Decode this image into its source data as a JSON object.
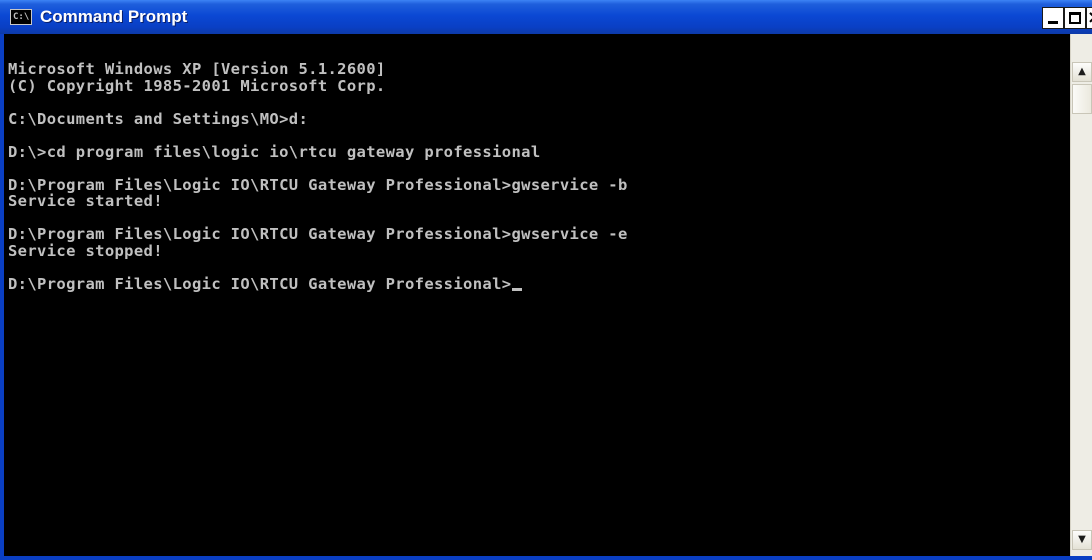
{
  "window": {
    "title": "Command Prompt",
    "icon_label": "C:\\",
    "icon": "console-icon",
    "controls": {
      "minimize_icon": "minimize-icon",
      "maximize_icon": "maximize-icon",
      "close_icon": "close-icon",
      "close_glyph": "×"
    }
  },
  "console": {
    "lines": [
      "Microsoft Windows XP [Version 5.1.2600]",
      "(C) Copyright 1985-2001 Microsoft Corp.",
      "",
      "C:\\Documents and Settings\\MO>d:",
      "",
      "D:\\>cd program files\\logic io\\rtcu gateway professional",
      "",
      "D:\\Program Files\\Logic IO\\RTCU Gateway Professional>gwservice -b",
      "Service started!",
      "",
      "D:\\Program Files\\Logic IO\\RTCU Gateway Professional>gwservice -e",
      "Service stopped!",
      "",
      "D:\\Program Files\\Logic IO\\RTCU Gateway Professional>"
    ],
    "text_color": "#c0c0c0",
    "background_color": "#000000"
  },
  "scrollbar": {
    "up_glyph": "▲",
    "down_glyph": "▼"
  },
  "theme": {
    "titlebar_color": "#0a48d4",
    "frame_color": "#0a3fc4"
  }
}
